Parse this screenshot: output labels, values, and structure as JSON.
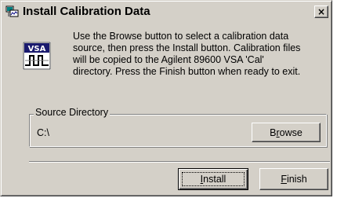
{
  "window": {
    "title": "Install Calibration Data",
    "close_label": "×"
  },
  "logo": {
    "text": "VSA"
  },
  "message": "Use the Browse button to select a calibration data\nsource, then press the Install button.  Calibration files\nwill be copied to the Agilent 89600 VSA 'Cal'\ndirectory.  Press the Finish button when ready to exit.",
  "source": {
    "group_label": "Source Directory",
    "path": "C:\\",
    "browse_pre": "B",
    "browse_mn": "r",
    "browse_post": "owse"
  },
  "buttons": {
    "install_mn": "I",
    "install_post": "nstall",
    "finish_mn": "F",
    "finish_post": "inish"
  }
}
